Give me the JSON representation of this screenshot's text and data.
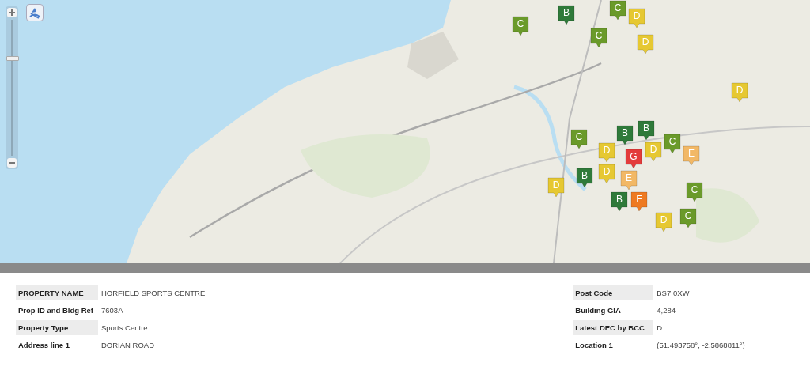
{
  "map": {
    "zoom_slider": {
      "level": 0.73
    },
    "markers": [
      {
        "label": "C",
        "color": "#6a9a2a"
      },
      {
        "label": "B",
        "color": "#2f7a3a"
      },
      {
        "label": "C",
        "color": "#6a9a2a"
      },
      {
        "label": "D",
        "color": "#e6c832"
      },
      {
        "label": "C",
        "color": "#6a9a2a"
      },
      {
        "label": "D",
        "color": "#e6c832"
      },
      {
        "label": "D",
        "color": "#e6c832"
      },
      {
        "label": "C",
        "color": "#6a9a2a"
      },
      {
        "label": "B",
        "color": "#2f7a3a"
      },
      {
        "label": "B",
        "color": "#2f7a3a"
      },
      {
        "label": "D",
        "color": "#e6c832"
      },
      {
        "label": "C",
        "color": "#6a9a2a"
      },
      {
        "label": "D",
        "color": "#e6c832"
      },
      {
        "label": "D",
        "color": "#e6c832"
      },
      {
        "label": "G",
        "color": "#e33b3b"
      },
      {
        "label": "E",
        "color": "#f2b866"
      },
      {
        "label": "B",
        "color": "#2f7a3a"
      },
      {
        "label": "D",
        "color": "#e6c832"
      },
      {
        "label": "E",
        "color": "#f2b866"
      },
      {
        "label": "B",
        "color": "#2f7a3a"
      },
      {
        "label": "F",
        "color": "#ee7a22"
      },
      {
        "label": "C",
        "color": "#6a9a2a"
      },
      {
        "label": "D",
        "color": "#e6c832"
      },
      {
        "label": "C",
        "color": "#6a9a2a"
      }
    ]
  },
  "details": {
    "left": [
      {
        "label": "PROPERTY NAME",
        "value": "HORFIELD SPORTS CENTRE"
      },
      {
        "label": "Prop ID and Bldg Ref",
        "value": "7603A"
      },
      {
        "label": "Property Type",
        "value": "Sports Centre"
      },
      {
        "label": "Address line 1",
        "value": "DORIAN ROAD"
      }
    ],
    "right": [
      {
        "label": "Post Code",
        "value": "BS7 0XW"
      },
      {
        "label": "Building GIA",
        "value": "4,284"
      },
      {
        "label": "Latest DEC by BCC",
        "value": "D"
      },
      {
        "label": "Location 1",
        "value": "(51.493758°, -2.5868811°)"
      }
    ]
  }
}
